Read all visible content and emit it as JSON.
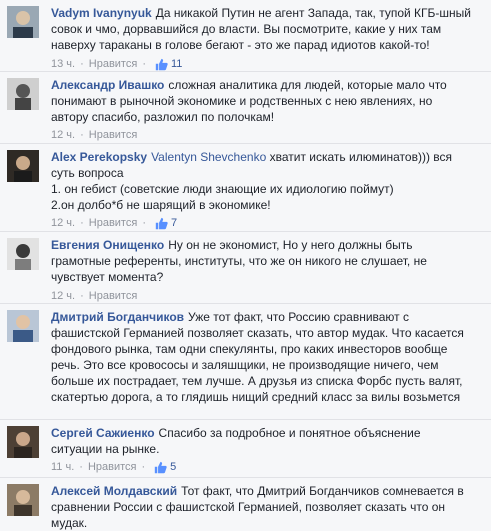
{
  "comments": [
    {
      "author": "Vadym Ivanynyuk",
      "text_lines": [
        "Да никакой Путин не агент Запада, так, тупой КГБ-шный",
        "совок и чмо, дорвавшийся до власти. Вы посмотрите, какие у них там",
        "наверху тараканы в голове бегают - это же парад идиотов какой-то!"
      ],
      "time": "13 ч.",
      "like_label": "Нравится",
      "likes": "11",
      "avatar_color": "#8a9aa6"
    },
    {
      "author": "Александр Ивашко",
      "text_lines": [
        "сложная аналитика для людей, которые мало что",
        "понимают в рыночной экономике и родственных с нею явлениях, но",
        "автору спасибо, разложил по полочкам!"
      ],
      "time": "12 ч.",
      "like_label": "Нравится",
      "likes": "",
      "avatar_color": "#6f6f6f"
    },
    {
      "author": "Alex Perekopsky",
      "mention": "Valentyn Shevchenko",
      "text_lines": [
        "хватит искать илюминатов))) вся",
        "суть вопроса",
        "1. он гебист (советские люди знающие их идиологию поймут)",
        "2.он долбо*б не шарящий в экономике!"
      ],
      "time": "12 ч.",
      "like_label": "Нравится",
      "likes": "7",
      "avatar_color": "#3f3a34"
    },
    {
      "author": "Евгения Онищенко",
      "text_lines": [
        "Ну он не экономист, Но у него должны быть",
        "грамотные референты, институты, что же он никого не слушает, не",
        "чувствует момента?"
      ],
      "time": "12 ч.",
      "like_label": "Нравится",
      "likes": "",
      "avatar_color": "#9b9b9b"
    },
    {
      "author": "Дмитрий Богданчиков",
      "text_lines": [
        "Уже тот факт, что Россию сравнивают с",
        "фашистской Германией позволяет сказать, что автор мудак. Что касается",
        "фондового рынка, там одни спекулянты, про каких инвесторов вообще",
        "речь. Это все кровососы и заляшщики, не производящие ничего, чем",
        "больше их пострадает, тем лучше. А друзья из списка Форбс пусть валят,",
        "скатертью дорога, а то глядишь нищий средний класс за вилы возьмется"
      ],
      "time": "",
      "like_label": "",
      "likes": "",
      "avatar_color": "#7a8a9e"
    },
    {
      "author": "Сергей Сажиенко",
      "text_lines": [
        "Спасибо за подробное и понятное объяснение",
        "ситуации на рынке."
      ],
      "time": "11 ч.",
      "like_label": "Нравится",
      "likes": "5",
      "avatar_color": "#5a4a3c"
    },
    {
      "author": "Алексей Молдавский",
      "text_lines": [
        "Тот факт, что Дмитрий Богданчиков сомневается в",
        "сравнении России с фашистской Германией, позволяет сказать что он",
        "мудак."
      ],
      "time": "",
      "like_label": "",
      "likes": "",
      "avatar_color": "#6b5e4e"
    }
  ]
}
